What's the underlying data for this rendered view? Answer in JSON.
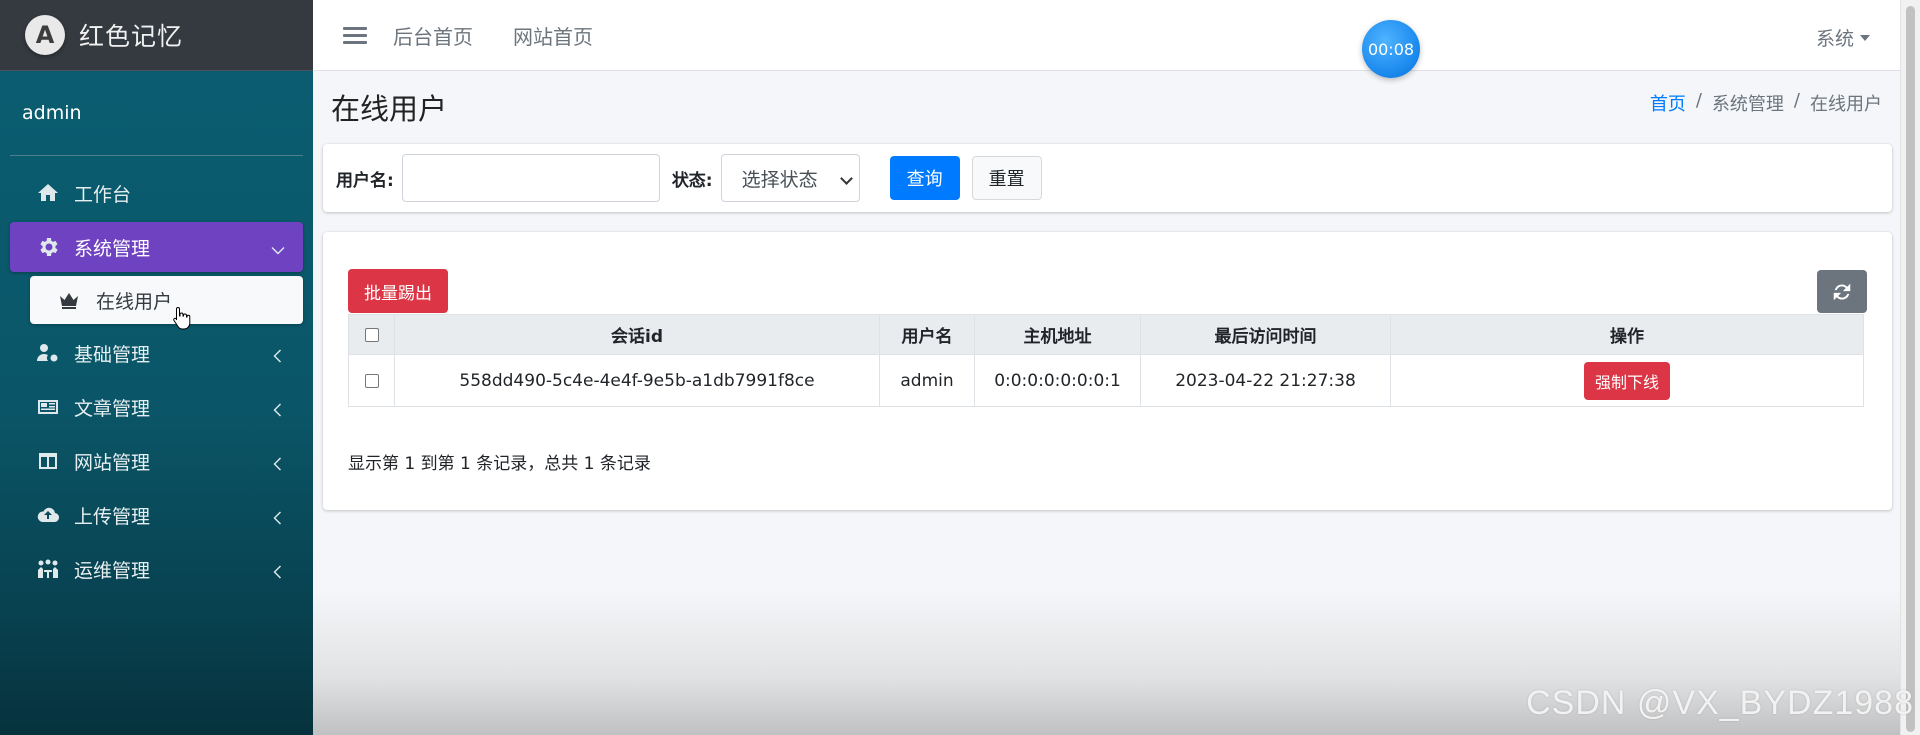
{
  "brand": {
    "logo_letter": "A",
    "name": "红色记忆"
  },
  "user": {
    "name": "admin"
  },
  "sidebar": {
    "items": [
      {
        "label": "工作台",
        "icon": "home-icon"
      },
      {
        "label": "系统管理",
        "icon": "gear-icon",
        "active": true
      },
      {
        "label": "基础管理",
        "icon": "users-cog-icon"
      },
      {
        "label": "文章管理",
        "icon": "newspaper-icon"
      },
      {
        "label": "网站管理",
        "icon": "columns-icon"
      },
      {
        "label": "上传管理",
        "icon": "cloud-upload-icon"
      },
      {
        "label": "运维管理",
        "icon": "people-meeting-icon"
      }
    ],
    "sub_items": [
      {
        "label": "在线用户",
        "icon": "crown-icon"
      }
    ]
  },
  "topbar": {
    "links": [
      "后台首页",
      "网站首页"
    ],
    "timer": "00:08",
    "system_menu": "系统"
  },
  "page": {
    "title": "在线用户",
    "breadcrumb": [
      "首页",
      "系统管理",
      "在线用户"
    ]
  },
  "search": {
    "username_label": "用户名:",
    "username_value": "",
    "status_label": "状态:",
    "status_selected": "选择状态",
    "query_button": "查询",
    "reset_button": "重置"
  },
  "table": {
    "bulk_button": "批量踢出",
    "columns": [
      "会话id",
      "用户名",
      "主机地址",
      "最后访问时间",
      "操作"
    ],
    "rows": [
      {
        "session_id": "558dd490-5c4e-4e4f-9e5b-a1db7991f8ce",
        "username": "admin",
        "host": "0:0:0:0:0:0:0:1",
        "last_access": "2023-04-22 21:27:38",
        "action": "强制下线"
      }
    ],
    "summary": "显示第 1 到第 1 条记录，总共 1 条记录"
  },
  "colors": {
    "sidebar_bg": "#0b5e72",
    "active_item": "#6f42c1",
    "primary": "#007bff",
    "danger": "#dc3545",
    "secondary": "#6c757d"
  },
  "watermark": "CSDN @VX_BYDZ1988"
}
